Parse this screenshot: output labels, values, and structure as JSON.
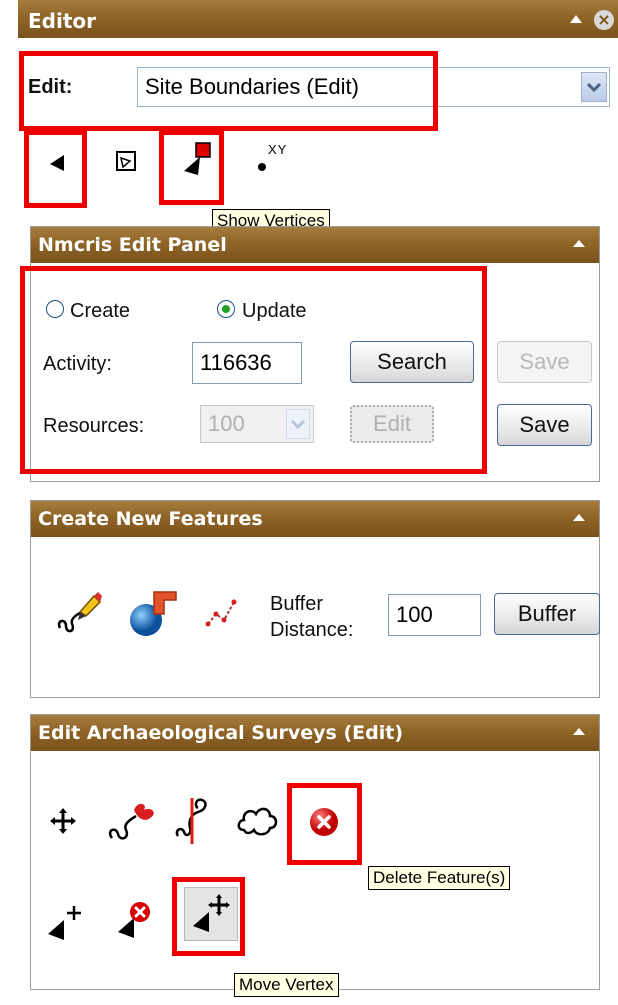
{
  "editor": {
    "title": "Editor",
    "edit_label": "Edit:",
    "edit_value": "Site Boundaries (Edit)",
    "coords_label": "XY",
    "tooltip": "Show Vertices"
  },
  "nmcris": {
    "title": "Nmcris Edit Panel",
    "create_label": "Create",
    "update_label": "Update",
    "selected_mode": "Update",
    "activity_label": "Activity:",
    "activity_value": "116636",
    "search_label": "Search",
    "save_label_1": "Save",
    "resources_label": "Resources:",
    "resources_value": "100",
    "edit_button_label": "Edit",
    "save_label_2": "Save"
  },
  "create_features": {
    "title": "Create New Features",
    "buffer_label_1": "Buffer",
    "buffer_label_2": "Distance:",
    "buffer_value": "100",
    "buffer_button": "Buffer"
  },
  "archaeo": {
    "title": "Edit Archaeological Surveys (Edit)",
    "tooltip_delete": "Delete Feature(s)",
    "tooltip_move": "Move Vertex"
  },
  "colors": {
    "header": "#8f6427",
    "highlight": "#ee0000",
    "tooltip_bg": "#ffffe1"
  }
}
